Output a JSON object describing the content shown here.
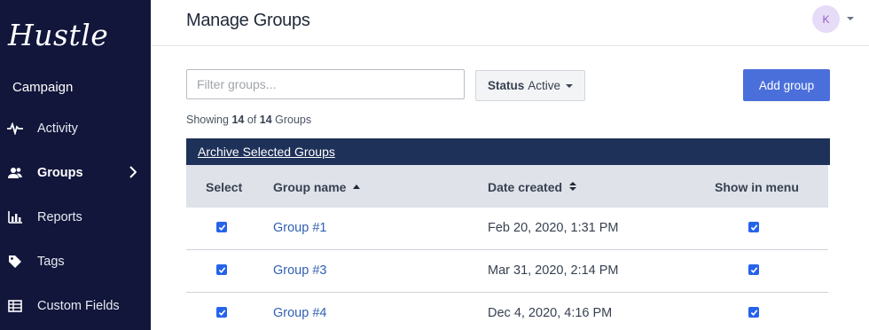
{
  "sidebar": {
    "logo": "Hustle",
    "section": "Campaign",
    "items": [
      {
        "label": "Activity"
      },
      {
        "label": "Groups"
      },
      {
        "label": "Reports"
      },
      {
        "label": "Tags"
      },
      {
        "label": "Custom Fields"
      }
    ]
  },
  "header": {
    "title": "Manage Groups",
    "avatar_initial": "K"
  },
  "controls": {
    "filter_placeholder": "Filter groups...",
    "status_label": "Status",
    "status_value": "Active",
    "add_group": "Add group"
  },
  "summary": {
    "prefix": "Showing",
    "shown": "14",
    "of": "of",
    "total": "14",
    "suffix": "Groups"
  },
  "table": {
    "archive_link": "Archive Selected Groups",
    "headers": {
      "select": "Select",
      "name": "Group name",
      "date": "Date created",
      "menu": "Show in menu"
    },
    "rows": [
      {
        "name": "Group #1",
        "date": "Feb 20, 2020, 1:31 PM",
        "selected": true,
        "show_in_menu": true
      },
      {
        "name": "Group #3",
        "date": "Mar 31, 2020, 2:14 PM",
        "selected": true,
        "show_in_menu": true
      },
      {
        "name": "Group #4",
        "date": "Dec 4, 2020, 4:16 PM",
        "selected": true,
        "show_in_menu": true
      }
    ]
  },
  "colors": {
    "sidebar_bg": "#12163b",
    "accent": "#4a6fdb",
    "archive_bar": "#1e3158",
    "link": "#2f5fb3",
    "checkbox": "#2563eb"
  }
}
